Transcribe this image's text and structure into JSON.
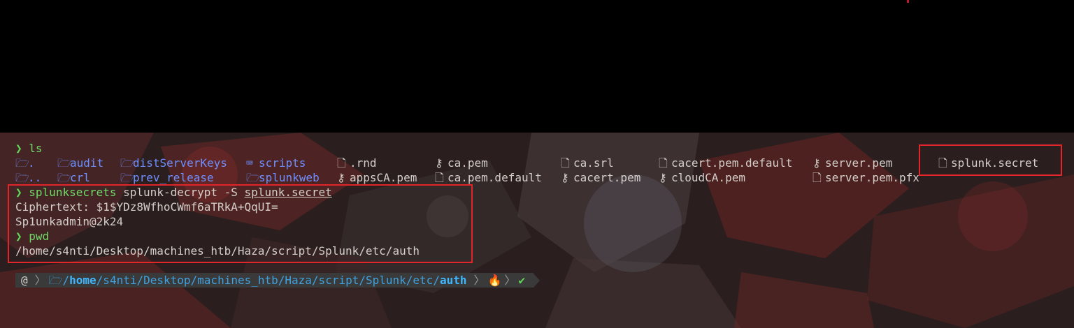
{
  "terminal": {
    "ls_command": {
      "prompt": "❯",
      "command": "ls"
    },
    "ls_listing": {
      "row1": [
        {
          "name": ".",
          "icon": "folder-open-icon",
          "type": "dir"
        },
        {
          "name": "audit",
          "icon": "folder-open-icon",
          "type": "dir"
        },
        {
          "name": "distServerKeys",
          "icon": "folder-open-icon",
          "type": "dir"
        },
        {
          "name": "scripts",
          "icon": "terminal-icon",
          "type": "dir"
        },
        {
          "name": ".rnd",
          "icon": "file-icon",
          "type": "file"
        },
        {
          "name": "ca.pem",
          "icon": "key-icon",
          "type": "file"
        },
        {
          "name": "ca.srl",
          "icon": "file-icon",
          "type": "file"
        },
        {
          "name": "cacert.pem.default",
          "icon": "file-icon",
          "type": "file"
        },
        {
          "name": "server.pem",
          "icon": "key-icon",
          "type": "file"
        },
        {
          "name": "splunk.secret",
          "icon": "file-icon",
          "type": "file"
        }
      ],
      "row2": [
        {
          "name": "..",
          "icon": "folder-open-icon",
          "type": "dir"
        },
        {
          "name": "crl",
          "icon": "folder-open-icon",
          "type": "dir"
        },
        {
          "name": "prev_release",
          "icon": "folder-open-icon",
          "type": "dir"
        },
        {
          "name": "splunkweb",
          "icon": "folder-open-icon",
          "type": "dir"
        },
        {
          "name": "appsCA.pem",
          "icon": "key-icon",
          "type": "file"
        },
        {
          "name": "ca.pem.default",
          "icon": "file-icon",
          "type": "file"
        },
        {
          "name": "cacert.pem",
          "icon": "key-icon",
          "type": "file"
        },
        {
          "name": "cloudCA.pem",
          "icon": "key-icon",
          "type": "file"
        },
        {
          "name": "server.pem.pfx",
          "icon": "file-icon",
          "type": "file"
        }
      ]
    },
    "decrypt_command": {
      "prompt": "❯",
      "program": "splunksecrets",
      "args": " splunk-decrypt -S ",
      "file": "splunk.secret"
    },
    "ciphertext_line": "Ciphertext: $1$YDz8WfhoCWmf6aTRkA+QqUI=",
    "plaintext_line": "Sp1unkadmin@2k24",
    "pwd_command": {
      "prompt": "❯",
      "command": "pwd"
    },
    "pwd_output": "/home/s4nti/Desktop/machines_htb/Haza/script/Splunk/etc/auth"
  },
  "powerline": {
    "os_icon": "debian-swirl-icon",
    "folder_icon": "folder-open-icon",
    "path_prefix": "/",
    "path_home": "home",
    "path_middle": "/s4nti/Desktop/machines_htb/Haza/script/Splunk/etc/",
    "path_last": "auth",
    "status_icon": "fire-icon",
    "ok_icon": "check-icon",
    "ok_glyph": "✔"
  },
  "colors": {
    "highlight_box": "#e0252b",
    "prompt": "#62d957",
    "dir": "#6e8fff",
    "path": "#3fa1e0"
  }
}
